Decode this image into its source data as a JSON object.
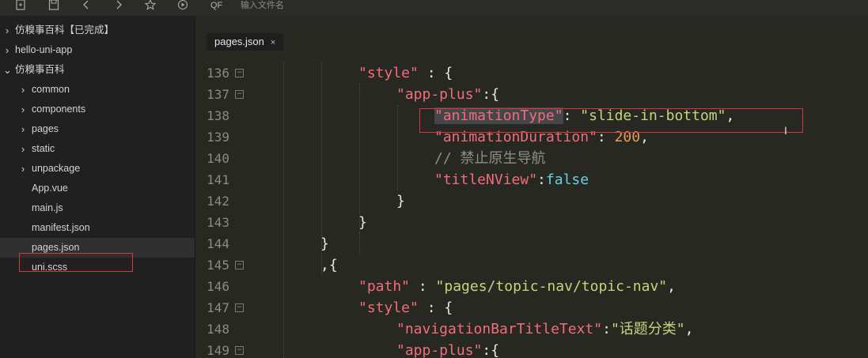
{
  "toolbar": {
    "icons": [
      "new-file-icon",
      "save-icon",
      "back-icon",
      "forward-icon",
      "star-icon",
      "run-icon"
    ],
    "search_icon": "QF",
    "search_placeholder": "输入文件名"
  },
  "sidebar": {
    "items": [
      {
        "label": "仿糗事百科【已完成】",
        "arrow": "›"
      },
      {
        "label": "hello-uni-app",
        "arrow": "›"
      },
      {
        "label": "仿糗事百科",
        "arrow": "⌄"
      },
      {
        "label": "common",
        "arrow": "›"
      },
      {
        "label": "components",
        "arrow": "›"
      },
      {
        "label": "pages",
        "arrow": "›"
      },
      {
        "label": "static",
        "arrow": "›"
      },
      {
        "label": "unpackage",
        "arrow": "›"
      },
      {
        "label": "App.vue",
        "arrow": ""
      },
      {
        "label": "main.js",
        "arrow": ""
      },
      {
        "label": "manifest.json",
        "arrow": ""
      },
      {
        "label": "pages.json",
        "arrow": ""
      },
      {
        "label": "uni.scss",
        "arrow": ""
      }
    ],
    "selected_item": "pages.json"
  },
  "editor": {
    "tab": {
      "label": "pages.json",
      "close": "×"
    },
    "fold_glyph": "⊟",
    "lines": [
      {
        "num": "136",
        "fold": true,
        "tokens": [
          {
            "t": "\"style\"",
            "c": "key"
          },
          {
            "t": " : {",
            "c": "pun"
          }
        ]
      },
      {
        "num": "137",
        "fold": true,
        "tokens": [
          {
            "t": "\"app-plus\"",
            "c": "key"
          },
          {
            "t": ":{",
            "c": "pun"
          }
        ]
      },
      {
        "num": "138",
        "fold": false,
        "tokens": [
          {
            "t": "\"animationType\"",
            "c": "key",
            "hl": true
          },
          {
            "t": ": ",
            "c": "pun"
          },
          {
            "t": "\"slide-in-bottom\"",
            "c": "str"
          },
          {
            "t": ",",
            "c": "pun"
          }
        ]
      },
      {
        "num": "139",
        "fold": false,
        "tokens": [
          {
            "t": "\"animationDuration\"",
            "c": "key"
          },
          {
            "t": ": ",
            "c": "pun"
          },
          {
            "t": "200",
            "c": "num"
          },
          {
            "t": ",",
            "c": "pun"
          }
        ]
      },
      {
        "num": "140",
        "fold": false,
        "tokens": [
          {
            "t": "// 禁止原生导航",
            "c": "com"
          }
        ]
      },
      {
        "num": "141",
        "fold": false,
        "tokens": [
          {
            "t": "\"titleNView\"",
            "c": "key"
          },
          {
            "t": ":",
            "c": "pun"
          },
          {
            "t": "false",
            "c": "bool"
          }
        ]
      },
      {
        "num": "142",
        "fold": false,
        "tokens": [
          {
            "t": "}",
            "c": "pun"
          }
        ]
      },
      {
        "num": "143",
        "fold": false,
        "tokens": [
          {
            "t": "}",
            "c": "pun"
          }
        ]
      },
      {
        "num": "144",
        "fold": false,
        "tokens": [
          {
            "t": "}",
            "c": "pun"
          }
        ]
      },
      {
        "num": "145",
        "fold": true,
        "tokens": [
          {
            "t": ",{",
            "c": "pun"
          }
        ]
      },
      {
        "num": "146",
        "fold": false,
        "tokens": [
          {
            "t": "\"path\"",
            "c": "key"
          },
          {
            "t": " : ",
            "c": "pun"
          },
          {
            "t": "\"pages/topic-nav/topic-nav\"",
            "c": "str"
          },
          {
            "t": ",",
            "c": "pun"
          }
        ]
      },
      {
        "num": "147",
        "fold": true,
        "tokens": [
          {
            "t": "\"style\"",
            "c": "key"
          },
          {
            "t": " : {",
            "c": "pun"
          }
        ]
      },
      {
        "num": "148",
        "fold": false,
        "tokens": [
          {
            "t": "\"navigationBarTitleText\"",
            "c": "key"
          },
          {
            "t": ":",
            "c": "pun"
          },
          {
            "t": "\"话题分类\"",
            "c": "str"
          },
          {
            "t": ",",
            "c": "pun"
          }
        ]
      },
      {
        "num": "149",
        "fold": true,
        "tokens": [
          {
            "t": "\"app-plus\"",
            "c": "key"
          },
          {
            "t": ":{",
            "c": "pun"
          }
        ]
      }
    ]
  },
  "cursor_glyph": "I",
  "colors": {
    "key": "#f26d7a",
    "string": "#c3d67a",
    "number": "#e69c54",
    "boolean": "#66d0e0",
    "comment": "#8e8e86",
    "annotation_box": "#d9353a"
  }
}
